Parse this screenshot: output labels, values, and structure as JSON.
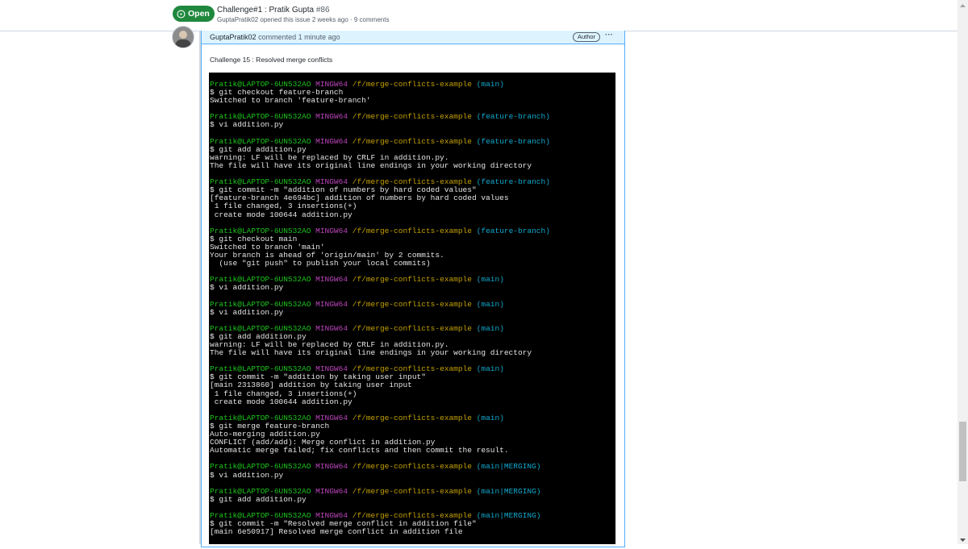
{
  "issue": {
    "state_label": "Open",
    "title": "Challenge#1 : Pratik Gupta",
    "number": "#86",
    "meta": "GuptaPratik02 opened this issue 2 weeks ago · 9 comments"
  },
  "comment": {
    "author": "GuptaPratik02",
    "action": "commented 1 minute ago",
    "badge": "Author",
    "menu": "···",
    "text": "Challenge 15 : Resolved merge conflicts"
  },
  "terminal": {
    "prompt_user": "Pratik@LAPTOP-6UN532AO",
    "prompt_host": "MINGW64",
    "prompt_path": "/f/merge-conflicts-example",
    "blocks": [
      {
        "branch": "(main)",
        "lines": [
          "$ git checkout feature-branch",
          "Switched to branch 'feature-branch'"
        ]
      },
      {
        "branch": "(feature-branch)",
        "lines": [
          "$ vi addition.py"
        ]
      },
      {
        "branch": "(feature-branch)",
        "lines": [
          "$ git add addition.py",
          "warning: LF will be replaced by CRLF in addition.py.",
          "The file will have its original line endings in your working directory"
        ]
      },
      {
        "branch": "(feature-branch)",
        "lines": [
          "$ git commit -m \"addition of numbers by hard coded values\"",
          "[feature-branch 4e694bc] addition of numbers by hard coded values",
          " 1 file changed, 3 insertions(+)",
          " create mode 100644 addition.py"
        ]
      },
      {
        "branch": "(feature-branch)",
        "lines": [
          "$ git checkout main",
          "Switched to branch 'main'",
          "Your branch is ahead of 'origin/main' by 2 commits.",
          "  (use \"git push\" to publish your local commits)"
        ]
      },
      {
        "branch": "(main)",
        "lines": [
          "$ vi addition.py"
        ]
      },
      {
        "branch": "(main)",
        "lines": [
          "$ vi addition.py"
        ]
      },
      {
        "branch": "(main)",
        "lines": [
          "$ git add addition.py",
          "warning: LF will be replaced by CRLF in addition.py.",
          "The file will have its original line endings in your working directory"
        ]
      },
      {
        "branch": "(main)",
        "lines": [
          "$ git commit -m \"addition by taking user input\"",
          "[main 2313860] addition by taking user input",
          " 1 file changed, 3 insertions(+)",
          " create mode 100644 addition.py"
        ]
      },
      {
        "branch": "(main)",
        "lines": [
          "$ git merge feature-branch",
          "Auto-merging addition.py",
          "CONFLICT (add/add): Merge conflict in addition.py",
          "Automatic merge failed; fix conflicts and then commit the result."
        ]
      },
      {
        "branch": "(main|MERGING)",
        "lines": [
          "$ vi addition.py"
        ]
      },
      {
        "branch": "(main|MERGING)",
        "lines": [
          "$ git add addition.py"
        ]
      },
      {
        "branch": "(main|MERGING)",
        "lines": [
          "$ git commit -m \"Resolved merge conflict in addition file\"",
          "[main 6e50917] Resolved merge conflict in addition file"
        ]
      }
    ]
  },
  "colors": {
    "open_green": "#1f883d",
    "header_blue": "#ddf4ff",
    "border_blue": "#54aeff",
    "term_user": "#1ec41e",
    "term_host": "#bb44bb",
    "term_path": "#c2a000",
    "term_branch": "#11a8cd"
  }
}
